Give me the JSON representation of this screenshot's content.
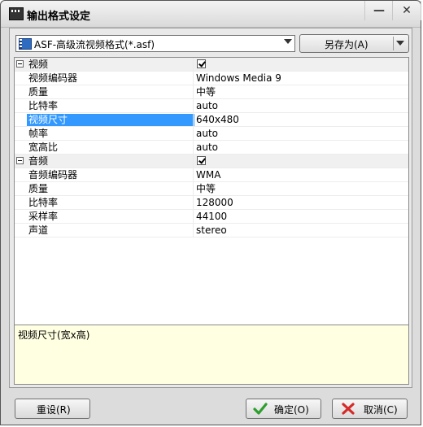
{
  "window": {
    "title": "输出格式设定",
    "minimize_glyph": "—",
    "close_glyph": "✕"
  },
  "format": {
    "selected": "ASF-高级流视频格式(*.asf)",
    "save_as_label": "另存为(A)"
  },
  "properties": {
    "video": {
      "group_label": "视频",
      "checked": true,
      "rows": [
        {
          "name": "视频编码器",
          "value": "Windows Media 9"
        },
        {
          "name": "质量",
          "value": "中等"
        },
        {
          "name": "比特率",
          "value": "auto"
        },
        {
          "name": "视频尺寸",
          "value": "640x480"
        },
        {
          "name": "帧率",
          "value": "auto"
        },
        {
          "name": "宽高比",
          "value": "auto"
        }
      ]
    },
    "audio": {
      "group_label": "音频",
      "checked": true,
      "rows": [
        {
          "name": "音频编码器",
          "value": "WMA"
        },
        {
          "name": "质量",
          "value": "中等"
        },
        {
          "name": "比特率",
          "value": "128000"
        },
        {
          "name": "采样率",
          "value": "44100"
        },
        {
          "name": "声道",
          "value": "stereo"
        }
      ]
    },
    "selected_row": "视频尺寸"
  },
  "description": {
    "text": "视频尺寸(宽x高)"
  },
  "buttons": {
    "reset": "重设(R)",
    "ok": "确定(O)",
    "cancel": "取消(C)"
  },
  "colors": {
    "selection": "#3399ff",
    "description_bg": "#ffffe1",
    "ok_check": "#2e9e2e",
    "cancel_cross": "#d42a2a"
  }
}
